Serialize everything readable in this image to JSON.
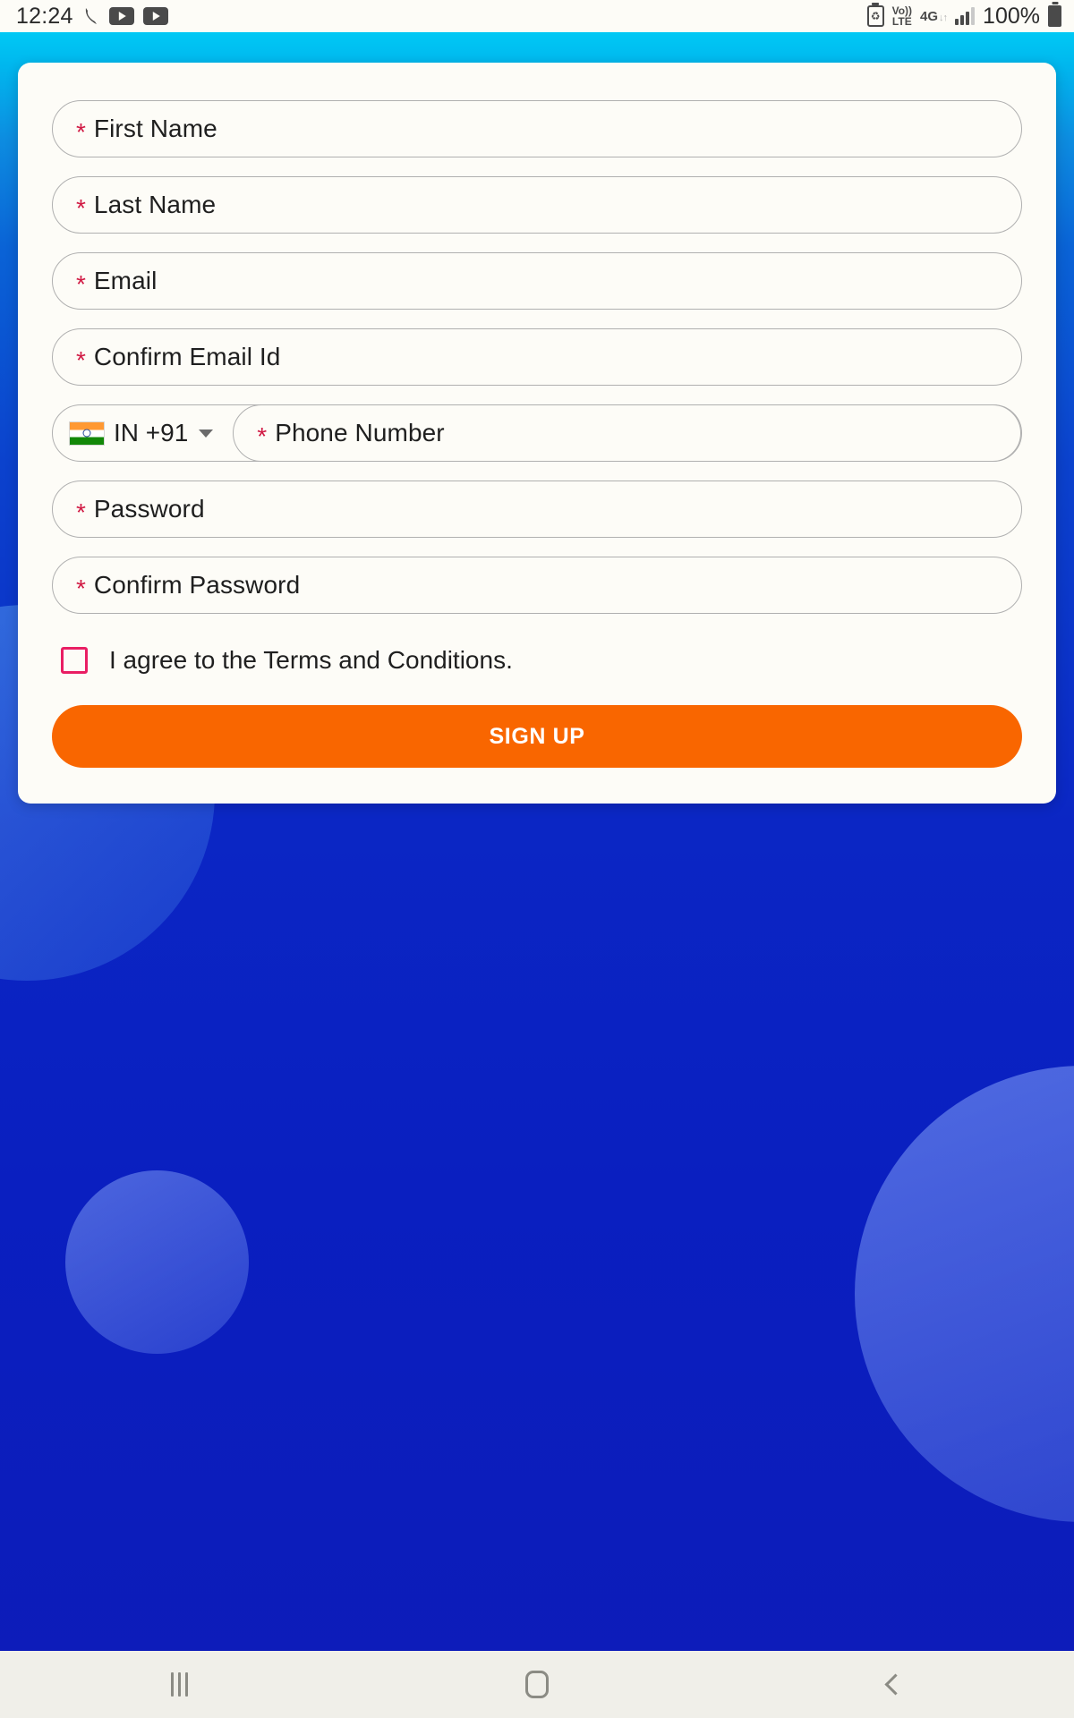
{
  "status_bar": {
    "time": "12:24",
    "icons": [
      "call-icon",
      "youtube-icon",
      "youtube-icon"
    ],
    "battery_saver_icon": "battery-saver-icon",
    "volte_line1": "Vo))",
    "volte_line2": "LTE",
    "network_type": "4G",
    "data_arrows": "↓↑",
    "battery_percent": "100%"
  },
  "form": {
    "required_marker": "*",
    "fields": [
      {
        "name": "first-name",
        "label": "First Name"
      },
      {
        "name": "last-name",
        "label": "Last Name"
      },
      {
        "name": "email",
        "label": "Email"
      },
      {
        "name": "confirm-email",
        "label": "Confirm Email Id"
      },
      {
        "name": "password",
        "label": "Password"
      },
      {
        "name": "confirm-password",
        "label": "Confirm Password"
      }
    ],
    "phone": {
      "country_code_label": "IN  +91",
      "country_flag": "india-flag-icon",
      "label": "Phone Number"
    },
    "terms": {
      "label": "I agree to the Terms and Conditions.",
      "checked": false
    },
    "submit_label": "SIGN UP"
  },
  "nav_bar": {
    "recents_label": "recents-icon",
    "home_label": "home-icon",
    "back_label": "back-icon"
  },
  "colors": {
    "accent_orange": "#f96600",
    "required_red": "#d11a44",
    "checkbox_pink": "#e91e63",
    "bg_cyan": "#00c9f5",
    "bg_blue": "#0d1cb9",
    "card_bg": "#fdfcf7"
  }
}
